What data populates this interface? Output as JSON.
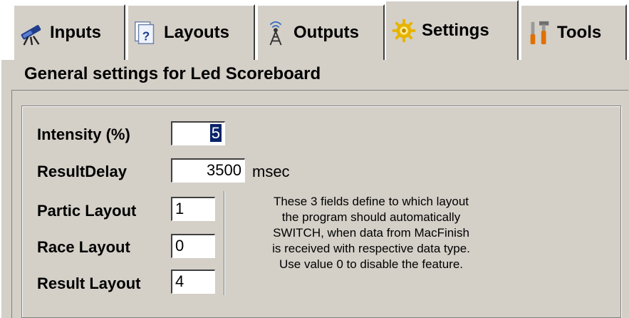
{
  "tabs": [
    {
      "label": "Inputs",
      "icon": "telescope-icon"
    },
    {
      "label": "Layouts",
      "icon": "help-pages-icon"
    },
    {
      "label": "Outputs",
      "icon": "antenna-icon"
    },
    {
      "label": "Settings",
      "icon": "gear-icon",
      "active": true
    },
    {
      "label": "Tools",
      "icon": "tools-icon"
    }
  ],
  "panel": {
    "title": "General settings for Led Scoreboard"
  },
  "fields": {
    "intensity": {
      "label": "Intensity (%)",
      "value": "5"
    },
    "result_delay": {
      "label": "ResultDelay",
      "value": "3500",
      "unit": "msec"
    },
    "partic_layout": {
      "label": "Partic Layout",
      "value": "1"
    },
    "race_layout": {
      "label": "Race Layout",
      "value": "0"
    },
    "result_layout": {
      "label": "Result Layout",
      "value": "4"
    }
  },
  "help_text": {
    "line1": "These 3 fields define to which layout",
    "line2": "the program should automatically",
    "line3": "SWITCH, when data from MacFinish",
    "line4": "is received with respective data type.",
    "line5": "Use value 0 to disable the feature."
  },
  "colors": {
    "face": "#d4d0c8",
    "selection": "#0a246a"
  }
}
